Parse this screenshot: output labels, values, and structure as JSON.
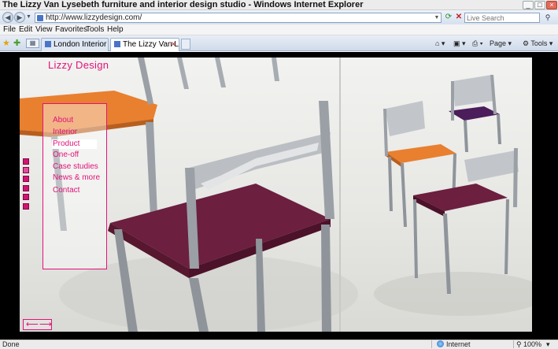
{
  "window": {
    "title": "The Lizzy Van Lysebeth furniture and interior design studio - Windows Internet Explorer",
    "controls": [
      "_",
      "□",
      "×"
    ]
  },
  "address_bar": {
    "url": "http://www.lizzydesign.com/",
    "search_placeholder": "Live Search"
  },
  "menu": [
    "File",
    "Edit",
    "View",
    "Favorites",
    "Tools",
    "Help"
  ],
  "tabs": [
    {
      "label": "London Interior de...",
      "active": false
    },
    {
      "label": "The Lizzy Van L...",
      "active": true
    }
  ],
  "command_bar": {
    "page_label": "Page",
    "tools_label": "Tools"
  },
  "site": {
    "logo": "Lizzy Design",
    "nav": [
      {
        "label": "About"
      },
      {
        "label": "Interior"
      },
      {
        "label": "Product",
        "selected": true
      },
      {
        "label": "One-off"
      },
      {
        "label": "Case studies"
      },
      {
        "label": "News & more"
      },
      {
        "label": "Contact"
      }
    ],
    "arrows": {
      "left": "⟵",
      "right": "⟶"
    }
  },
  "status": {
    "left": "Done",
    "zone": "Internet",
    "zoom": "100%"
  },
  "colors": {
    "accent": "#e0137a",
    "seat_orange": "#e8802f",
    "seat_plum": "#6c1f3f",
    "seat_purple": "#4b1d5a",
    "frame": "#9aa0a6"
  }
}
